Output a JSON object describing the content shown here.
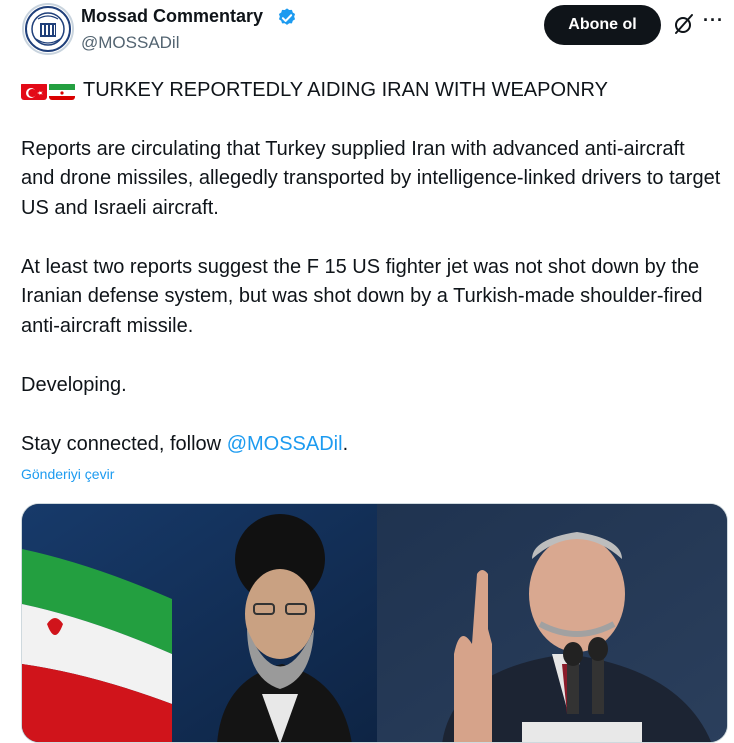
{
  "tweet": {
    "author": {
      "display_name": "Mossad Commentary",
      "handle": "@MOSSADil",
      "verified": true,
      "avatar_icon": "mossad-emblem-icon"
    },
    "actions": {
      "subscribe_label": "Abone ol",
      "grok_icon": "grok-icon",
      "more_icon": "more-options-icon"
    },
    "headline_flags": [
      "turkey-flag-icon",
      "iran-flag-icon"
    ],
    "headline": "TURKEY REPORTEDLY AIDING IRAN WITH WEAPONRY",
    "paragraph_1": "Reports are circulating  that Turkey supplied Iran with advanced anti-aircraft and drone missiles, allegedly transported by intelligence-linked drivers to target US and Israeli aircraft.",
    "paragraph_2": "At least two reports suggest the F 15 US fighter jet was not shot down by the Iranian defense system, but was shot down by a Turkish-made shoulder-fired anti-aircraft missile.",
    "paragraph_3": "Developing.",
    "paragraph_4_prefix": "Stay connected, follow ",
    "paragraph_4_mention": "@MOSSADil",
    "paragraph_4_suffix": ".",
    "translate_label": "Gönderiyi çevir",
    "media": {
      "type": "photo",
      "description_icons": [
        "iran-flag-icon",
        "cleric-portrait",
        "erdogan-portrait"
      ]
    }
  },
  "colors": {
    "text": "#0f1419",
    "secondary": "#536471",
    "link": "#1d9bf0",
    "button_bg": "#0f1419",
    "verified": "#1d9bf0"
  }
}
